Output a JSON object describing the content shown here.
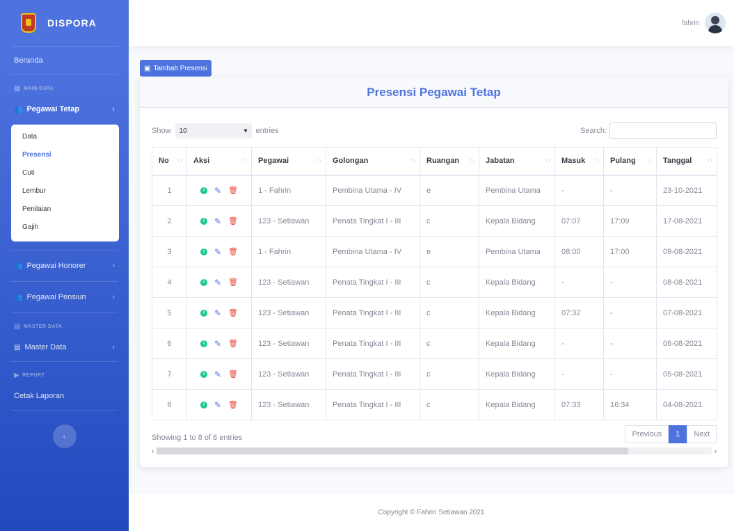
{
  "brand": {
    "name": "DISPORA"
  },
  "sidebar": {
    "beranda": "Beranda",
    "heading_main": "MAIN DATA",
    "pegawai_tetap": "Pegawai Tetap",
    "submenu": [
      "Data",
      "Presensi",
      "Cuti",
      "Lembur",
      "Penilaian",
      "Gajih"
    ],
    "pegawai_honorer": "Pegawai Honorer",
    "pegawai_pensiun": "Pegawai Pensiun",
    "heading_master": "MASTER DATA",
    "master_data": "Master Data",
    "heading_report": "REPORT",
    "cetak_laporan": "Cetak Laporan"
  },
  "topbar": {
    "username": "fahrin"
  },
  "toolbar": {
    "add_label": "Tambah Presensi"
  },
  "card": {
    "title": "Presensi Pegawai Tetap"
  },
  "controls": {
    "show": "Show",
    "entries_value": "10",
    "entries": "entries",
    "search": "Search:"
  },
  "table": {
    "headers": [
      "No",
      "Aksi",
      "Pegawai",
      "Golongan",
      "Ruangan",
      "Jabatan",
      "Masuk",
      "Pulang",
      "Tanggal"
    ],
    "rows": [
      [
        "1",
        "1 - Fahrin",
        "Pembina Utama - IV",
        "e",
        "Pembina Utama",
        "-",
        "-",
        "23-10-2021"
      ],
      [
        "2",
        "123 - Setiawan",
        "Penata Tingkat I - III",
        "c",
        "Kepala Bidang",
        "07:07",
        "17:09",
        "17-08-2021"
      ],
      [
        "3",
        "1 - Fahrin",
        "Pembina Utama - IV",
        "e",
        "Pembina Utama",
        "08:00",
        "17:00",
        "09-08-2021"
      ],
      [
        "4",
        "123 - Setiawan",
        "Penata Tingkat I - III",
        "c",
        "Kepala Bidang",
        "-",
        "-",
        "08-08-2021"
      ],
      [
        "5",
        "123 - Setiawan",
        "Penata Tingkat I - III",
        "c",
        "Kepala Bidang",
        "07:32",
        "-",
        "07-08-2021"
      ],
      [
        "6",
        "123 - Setiawan",
        "Penata Tingkat I - III",
        "c",
        "Kepala Bidang",
        "-",
        "-",
        "06-08-2021"
      ],
      [
        "7",
        "123 - Setiawan",
        "Penata Tingkat I - III",
        "c",
        "Kepala Bidang",
        "-",
        "-",
        "05-08-2021"
      ],
      [
        "8",
        "123 - Setiawan",
        "Penata Tingkat I - III",
        "c",
        "Kepala Bidang",
        "07:33",
        "16:34",
        "04-08-2021"
      ]
    ]
  },
  "pagination": {
    "info": "Showing 1 to 8 of 8 entries",
    "previous": "Previous",
    "current": "1",
    "next": "Next"
  },
  "footer": {
    "copyright": "Copyright © Fahrin Setiawan 2021"
  },
  "colors": {
    "primary": "#4e73df",
    "success": "#1cc88a",
    "danger": "#e74a3b"
  }
}
